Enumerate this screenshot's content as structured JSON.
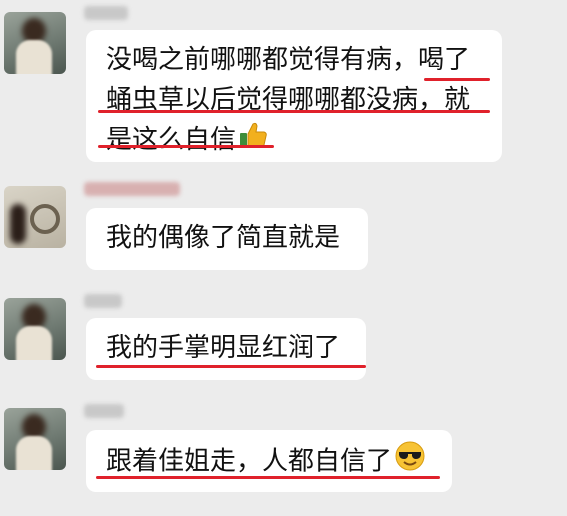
{
  "messages": [
    {
      "text_lines": [
        "没喝之前哪哪都觉得有病，喝了",
        "蛹虫草以后觉得哪哪都没病，就",
        "是这么自信"
      ],
      "emoji": "thumbs-up-icon"
    },
    {
      "text_lines": [
        "我的偶像了简直就是"
      ]
    },
    {
      "text_lines": [
        "我的手掌明显红润了"
      ]
    },
    {
      "text_lines": [
        "跟着佳姐走，人都自信了"
      ],
      "emoji": "cool-face-icon"
    }
  ],
  "colors": {
    "background": "#ececec",
    "bubble": "#ffffff",
    "underline": "#e0212b"
  }
}
